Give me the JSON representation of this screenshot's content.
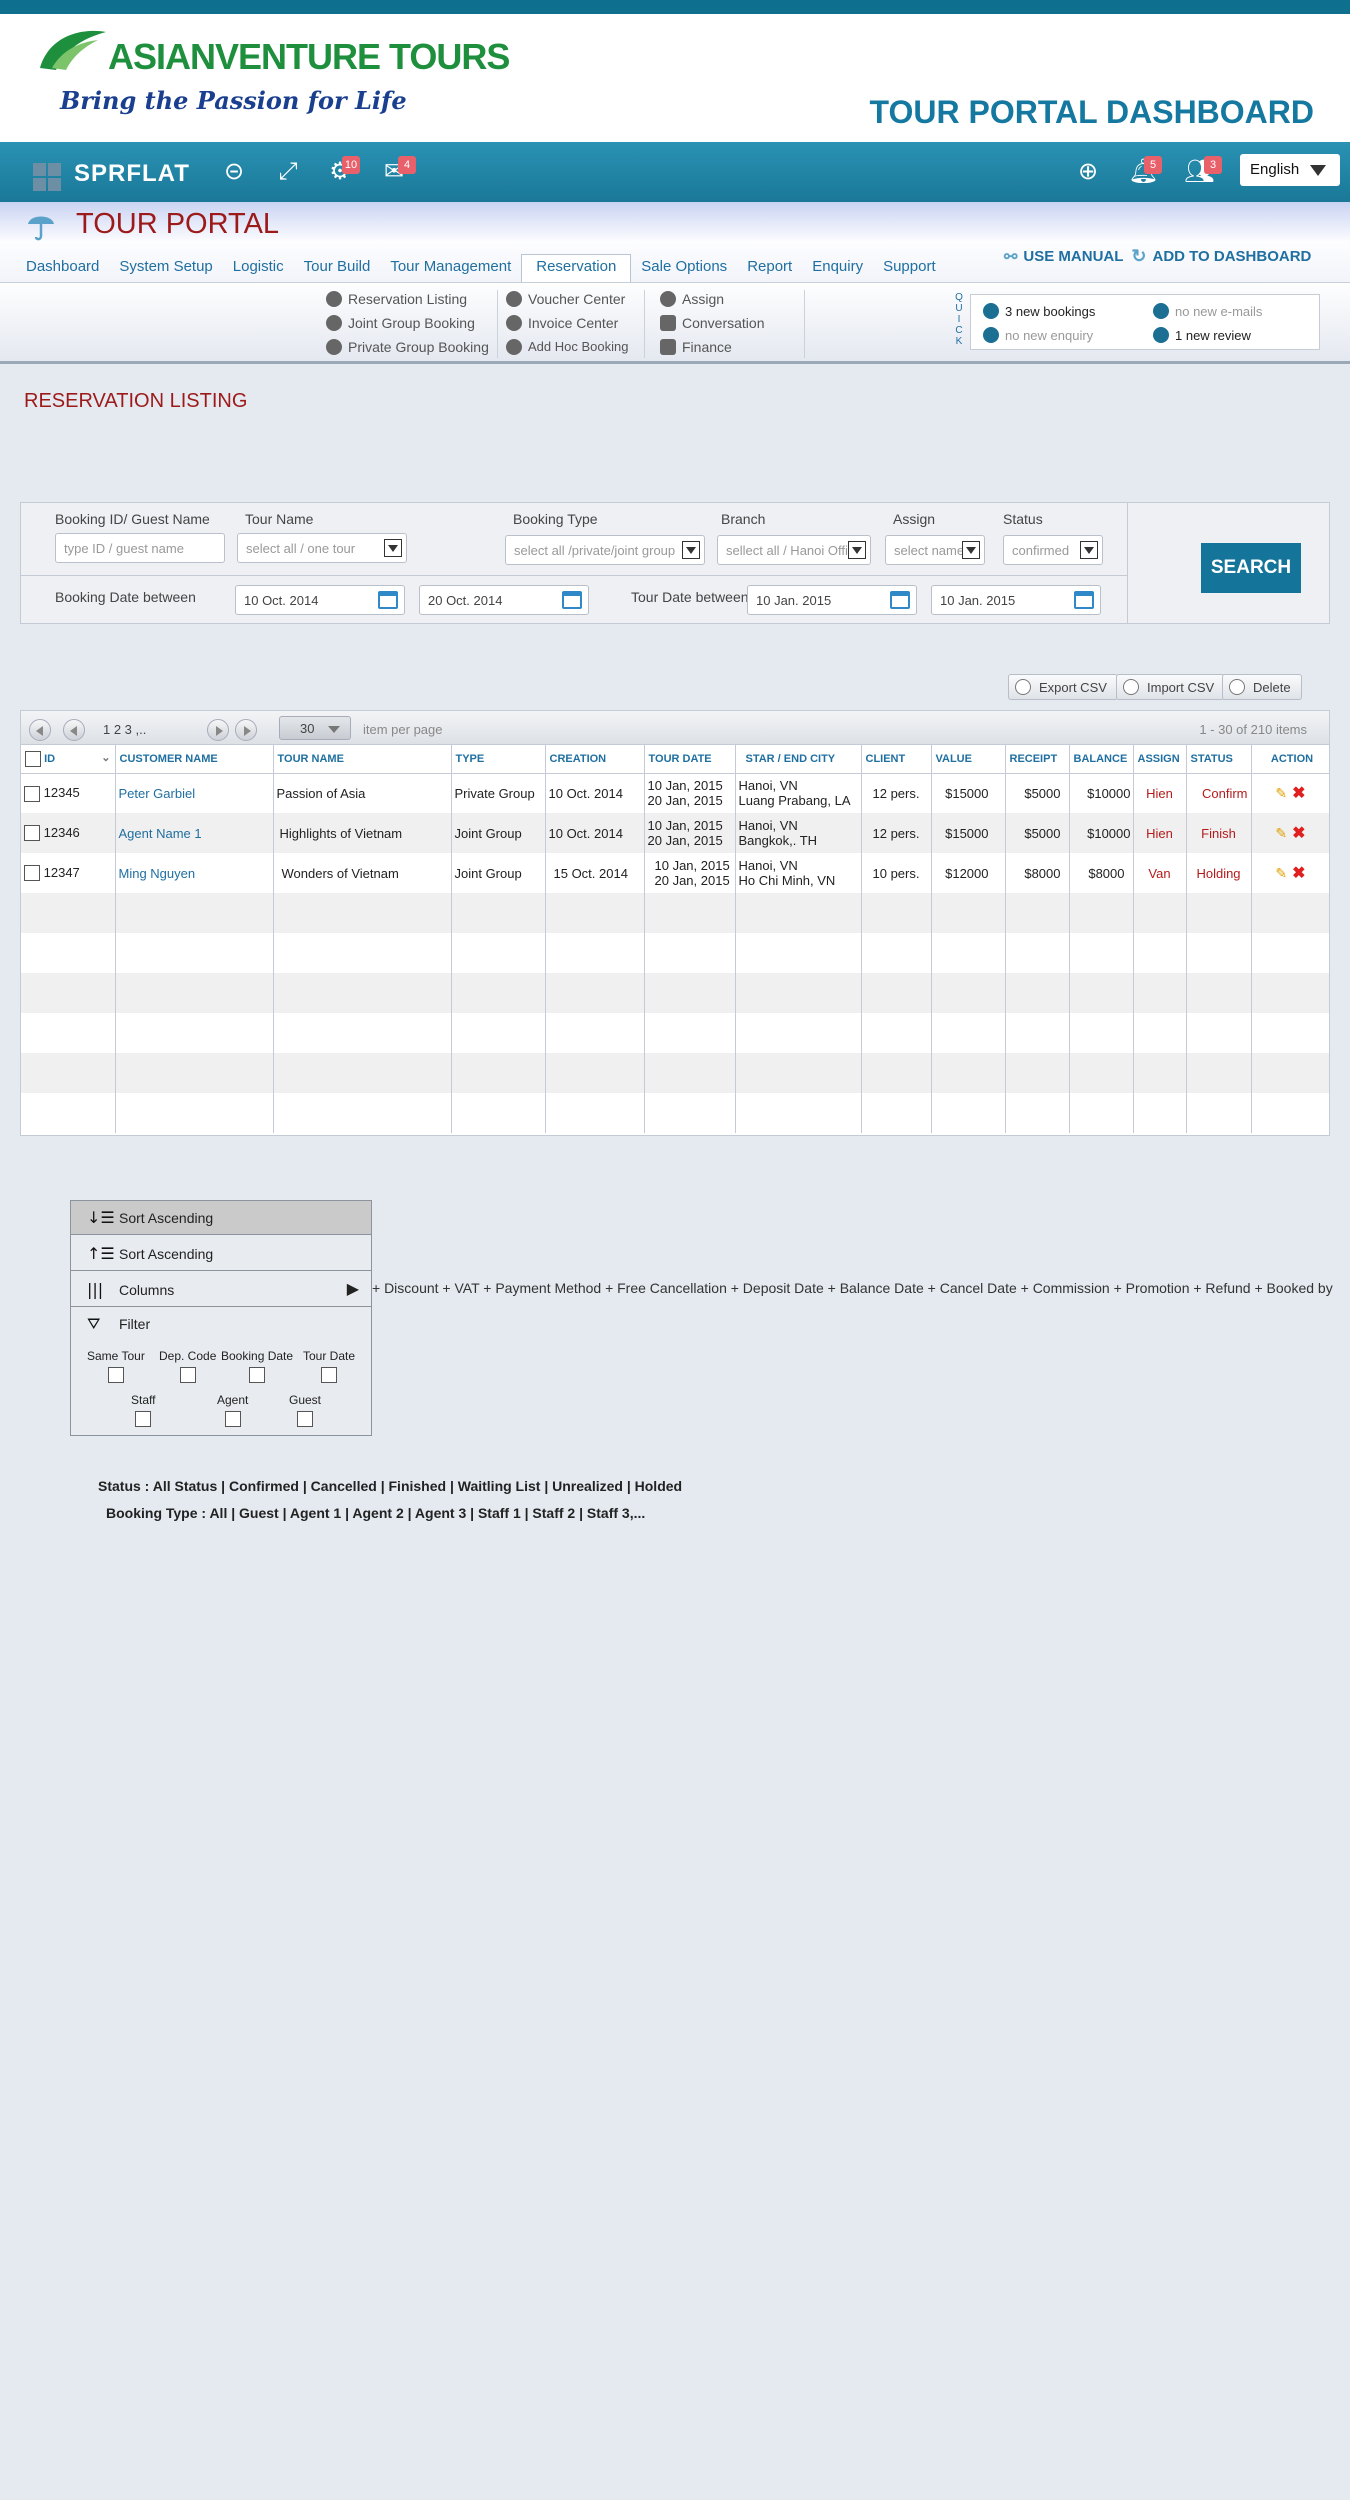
{
  "header": {
    "logo_main": "ASIANVENTURE TOURS",
    "logo_tagline": "Bring the Passion for Life",
    "dashboard_title": "TOUR PORTAL DASHBOARD"
  },
  "topbar": {
    "brand": "SPRFLAT",
    "settings_badge": "10",
    "mail_badge": "4",
    "bell_badge": "5",
    "users_badge": "3",
    "language": "English"
  },
  "portal": {
    "title": "TOUR PORTAL",
    "use_manual": "USE MANUAL",
    "add_to_dashboard": "ADD TO  DASHBOARD"
  },
  "nav": {
    "items": [
      "Dashboard",
      "System Setup",
      "Logistic",
      "Tour Build",
      "Tour Management",
      "Reservation",
      "Sale Options",
      "Report",
      "Enquiry",
      "Support"
    ],
    "active": "Reservation"
  },
  "submenu": {
    "col1": [
      "Reservation Listing",
      "Joint Group Booking",
      "Private Group Booking"
    ],
    "col2": [
      "Voucher Center",
      "Invoice Center",
      "Add Hoc Booking"
    ],
    "col3": [
      "Assign",
      "Conversation",
      "Finance"
    ]
  },
  "quick": {
    "label": "QUICK",
    "bookings": "3 new bookings",
    "emails": "no new e-mails",
    "enquiry": "no new enquiry",
    "review": "1 new review"
  },
  "section_title": "RESERVATION LISTING",
  "search": {
    "booking_id_label": "Booking ID/ Guest Name",
    "booking_id_placeholder": "type ID / guest name",
    "tour_name_label": "Tour Name",
    "tour_name_value": "select all / one tour",
    "booking_type_label": "Booking Type",
    "booking_type_value": "select all /private/joint group",
    "branch_label": "Branch",
    "branch_value": "sellect all / Hanoi Office",
    "assign_label": "Assign",
    "assign_value": "select name",
    "status_label": "Status",
    "status_value": "confirmed",
    "booking_date_label": "Booking Date  between",
    "booking_date_from": "10 Oct. 2014",
    "booking_date_to": "20 Oct. 2014",
    "tour_date_label": "Tour Date between",
    "tour_date_from": "10 Jan. 2015",
    "tour_date_to": "10 Jan. 2015",
    "search_button": "SEARCH"
  },
  "actions": {
    "export_csv": "Export CSV",
    "import_csv": "Import CSV",
    "delete": "Delete"
  },
  "pager": {
    "pages": "1  2  3 ,..",
    "page_size": "30",
    "items_per_page": "item per page",
    "count": "1 - 30   of 210 items"
  },
  "table": {
    "columns": [
      "ID",
      "CUSTOMER  NAME",
      "TOUR  NAME",
      "TYPE",
      "CREATION",
      "TOUR DATE",
      "STAR / END CITY",
      "CLIENT",
      "VALUE",
      "RECEIPT",
      "BALANCE",
      "ASSIGN",
      "STATUS",
      "ACTION"
    ],
    "rows": [
      {
        "id": "12345",
        "customer": "Peter Garbiel",
        "tour": "Passion of Asia",
        "type": "Private Group",
        "creation": "10 Oct. 2014",
        "date1": "10 Jan, 2015",
        "date2": "20 Jan, 2015",
        "city1": "Hanoi, VN",
        "city2": "Luang Prabang, LA",
        "client": "12 pers.",
        "value": "$15000",
        "receipt": "$5000",
        "balance": "$10000",
        "assign": "Hien",
        "status": "Confirm"
      },
      {
        "id": "12346",
        "customer": "Agent Name 1",
        "tour": "Highlights of Vietnam",
        "type": "Joint Group",
        "creation": "10 Oct. 2014",
        "date1": "10 Jan, 2015",
        "date2": "20 Jan, 2015",
        "city1": "Hanoi, VN",
        "city2": "Bangkok,. TH",
        "client": "12 pers.",
        "value": "$15000",
        "receipt": "$5000",
        "balance": "$10000",
        "assign": "Hien",
        "status": "Finish"
      },
      {
        "id": "12347",
        "customer": "Ming Nguyen",
        "tour": "Wonders of Vietnam",
        "type": "Joint Group",
        "creation": "15 Oct. 2014",
        "date1": "10 Jan, 2015",
        "date2": "20 Jan, 2015",
        "city1": "Hanoi, VN",
        "city2": "Ho Chi Minh, VN",
        "client": "10 pers.",
        "value": "$12000",
        "receipt": "$8000",
        "balance": "$8000",
        "assign": "Van",
        "status": "Holding"
      }
    ]
  },
  "context_menu": {
    "sort_asc_1": "Sort Ascending",
    "sort_asc_2": "Sort Ascending",
    "columns": "Columns",
    "filter": "Filter",
    "filter_options": [
      "Same Tour",
      "Dep. Code",
      "Booking Date",
      "Tour Date",
      "Staff",
      "Agent",
      "Guest"
    ],
    "column_options": "+ Discount  + VAT  + Payment Method + Free Cancellation +  Deposit Date    + Balance Date  + Cancel Date + Commission  + Promotion + Refund    + Booked by"
  },
  "notes": {
    "status": "Status : All Status | Confirmed | Cancelled | Finished | Waitling List  | Unrealized  | Holded",
    "booking_type": "Booking Type : All | Guest | Agent 1 | Agent 2 | Agent 3 | Staff 1 | Staff 2 | Staff 3,..."
  }
}
